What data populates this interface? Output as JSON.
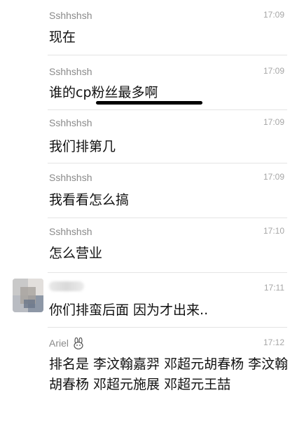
{
  "messages": [
    {
      "sender": "Sshhshsh",
      "time": "17:09",
      "text": "现在"
    },
    {
      "sender": "Sshhshsh",
      "time": "17:09",
      "text": "谁的cp粉丝最多啊"
    },
    {
      "sender": "Sshhshsh",
      "time": "17:09",
      "text": "我们排第几"
    },
    {
      "sender": "Sshhshsh",
      "time": "17:09",
      "text": "我看看怎么搞"
    },
    {
      "sender": "Sshhshsh",
      "time": "17:10",
      "text": "怎么营业"
    },
    {
      "sender": "",
      "time": "17:11",
      "text": "你们排蛮后面 因为才出来.."
    },
    {
      "sender": "Ariel",
      "time": "17:12",
      "text": "排名是 李汶翰嘉羿 邓超元胡春杨 李汶翰胡春杨 邓超元施展 邓超元王喆"
    }
  ],
  "icons": {
    "avatar": "blurred-avatar",
    "sender_badge": "bunny-icon"
  },
  "colors": {
    "sender": "#8a8a8a",
    "time": "#a6a6a6",
    "text": "#111111",
    "divider": "#e4e4e4",
    "annotation": "#000000"
  }
}
